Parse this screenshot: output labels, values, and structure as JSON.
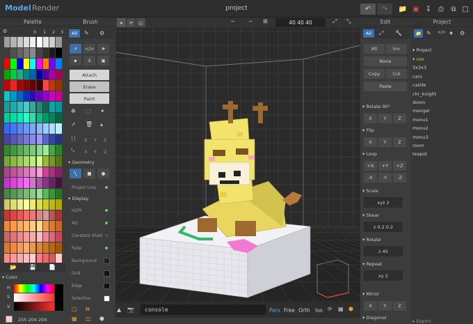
{
  "topbar": {
    "mode_model": "Model",
    "mode_render": "Render",
    "title": "project"
  },
  "palette": {
    "title": "Palette",
    "page_buttons": [
      "0",
      "1",
      "2",
      "3"
    ],
    "color_label": "Color",
    "hsv_labels": [
      "H",
      "S",
      "V"
    ],
    "rgb_value": "255 204 204",
    "swatches": [
      [
        "#a0a0a0",
        "#b4b4b4",
        "#c8c8c8",
        "#dcdcdc",
        "#f0f0f0",
        "#ffffff",
        "#e6e6e6",
        "#cfcfcf",
        "#9a9a9a"
      ],
      [
        "#3c3c3c",
        "#505050",
        "#646464",
        "#787878",
        "#8c8c8c",
        "#444444",
        "#303030",
        "#1c1c1c",
        "#000000"
      ],
      [
        "#ff0000",
        "#00ff00",
        "#0000ff",
        "#ffff00",
        "#00ffff",
        "#ff00ff",
        "#ff8000",
        "#8000ff",
        "#0080ff"
      ],
      [
        "#00aa00",
        "#00cc44",
        "#22aa88",
        "#008888",
        "#0066aa",
        "#0000aa",
        "#5500aa",
        "#aa00aa",
        "#aa0055"
      ],
      [
        "#cc0000",
        "#ee2222",
        "#aa0000",
        "#880000",
        "#660000",
        "#440000",
        "#ff4444",
        "#cc3300",
        "#993300"
      ],
      [
        "#00cccc",
        "#0099cc",
        "#0066cc",
        "#0033cc",
        "#3300cc",
        "#6600cc",
        "#9900cc",
        "#cc00cc",
        "#cc0099"
      ],
      [
        "#229999",
        "#22aaaa",
        "#33bbbb",
        "#44cccc",
        "#33aa99",
        "#228877",
        "#116655",
        "#00aaaa",
        "#009999"
      ],
      [
        "#00cc99",
        "#00ddaa",
        "#00eebb",
        "#22ffcc",
        "#33ddaa",
        "#11bb88",
        "#009966",
        "#008855",
        "#006644"
      ],
      [
        "#3366ff",
        "#4477ff",
        "#5588ff",
        "#6699ff",
        "#77aaff",
        "#88bbff",
        "#99ccff",
        "#aaddff",
        "#bbeeff"
      ],
      [
        "#4444aa",
        "#5555bb",
        "#6666cc",
        "#7777dd",
        "#8888ee",
        "#9999ff",
        "#5566cc",
        "#3344aa",
        "#223388"
      ],
      [
        "#338833",
        "#449944",
        "#55aa55",
        "#66bb66",
        "#77cc77",
        "#88dd88",
        "#99ee99",
        "#44aa44",
        "#228822"
      ],
      [
        "#77aa33",
        "#88bb44",
        "#99cc55",
        "#aadd66",
        "#bbee77",
        "#ccff88",
        "#99bb33",
        "#779922",
        "#557711"
      ],
      [
        "#aa4488",
        "#bb5599",
        "#cc66aa",
        "#dd77bb",
        "#ee88cc",
        "#ff99dd",
        "#cc4499",
        "#aa3377",
        "#882266"
      ],
      [
        "#cc33cc",
        "#dd44dd",
        "#ee55ee",
        "#ff66ff",
        "#cc77cc",
        "#aa55aa",
        "#883388",
        "#662266",
        "#441144"
      ],
      [
        "#448844",
        "#559955",
        "#66aa66",
        "#77bb77",
        "#88cc88",
        "#99dd99",
        "#55bb55",
        "#339933",
        "#227722"
      ],
      [
        "#cccc66",
        "#dddd77",
        "#eeee88",
        "#ffff99",
        "#eeee66",
        "#dddd44",
        "#cccc22",
        "#bbbb00",
        "#aaaa00"
      ],
      [
        "#cc3333",
        "#dd4444",
        "#ee5555",
        "#ff6666",
        "#ee7777",
        "#dd8888",
        "#cc9999",
        "#bb5555",
        "#aa3333"
      ],
      [
        "#ee8833",
        "#ff9944",
        "#ffaa55",
        "#ffbb66",
        "#ffcc77",
        "#ffdd88",
        "#ee9955",
        "#dd7733",
        "#cc6622"
      ],
      [
        "#cc6666",
        "#dd7777",
        "#ee8888",
        "#ff9999",
        "#ffaaaa",
        "#ffbbbb",
        "#ee8899",
        "#dd6677",
        "#cc4455"
      ],
      [
        "#dd7733",
        "#ee8844",
        "#ff9955",
        "#ffaa66",
        "#ee9944",
        "#dd8833",
        "#cc7722",
        "#bb6611",
        "#aa5500"
      ],
      [
        "#ff8888",
        "#ff9999",
        "#ffaaaa",
        "#ffbbbb",
        "#ffcccc",
        "#ff7777",
        "#ee6666",
        "#dd5555",
        "#ffcccc"
      ]
    ]
  },
  "brush": {
    "title": "Brush",
    "all_tab": "All",
    "attach": "Attach",
    "erase": "Erase",
    "paint": "Paint",
    "mirror_xyz": [
      "X",
      "Y",
      "Z"
    ],
    "geometry_label": "Geometry",
    "project_line": "Project Line",
    "display_label": "Display",
    "display_items": [
      "HDPI",
      "AO",
      "Constant Shad",
      "Fade",
      "Background",
      "Grid",
      "Edge",
      "Selection"
    ]
  },
  "viewport": {
    "dimensions": "40 40 40",
    "console_placeholder": "console",
    "view_modes": [
      "Pers",
      "Free",
      "Orth",
      "Iso"
    ],
    "active_view": "Pers"
  },
  "edit": {
    "title": "Edit",
    "all_tab": "All",
    "select_all": "All",
    "select_inv": "Inv",
    "select_none": "None",
    "copy": "Copy",
    "cut": "Cut",
    "paste": "Paste",
    "rotate90_label": "Rotate 90°",
    "flip_label": "Flip",
    "loop_label": "Loop",
    "axes": [
      "X",
      "Y",
      "Z"
    ],
    "loop_plus": [
      "+X",
      "+Y",
      "+Z"
    ],
    "loop_minus": [
      "-X",
      "-Y",
      "-Z"
    ],
    "scale_label": "Scale",
    "scale_value": "xyz 2",
    "shear_label": "Shear",
    "shear_value": "z 0.2 0.2",
    "rotate_label": "Rotate",
    "rotate_value": "z 45",
    "repeat_label": "Repeat",
    "repeat_value": "xy 2",
    "mirror_label": "Mirror",
    "diagonal_label": "Diagonal"
  },
  "project": {
    "title": "Project",
    "root": "Project",
    "files": [
      "vox",
      "3x3x3",
      "cars",
      "castle",
      "chr_knight",
      "doom",
      "menger",
      "monu1",
      "monu2",
      "monu3",
      "room",
      "teapot"
    ],
    "active_file": "vox",
    "export_label": "Export"
  },
  "colors": {
    "accent": "#5aa8e8",
    "active_file": "#f0c040",
    "voxel_yellow": "#f2e36a",
    "voxel_white": "#f4f4f8"
  }
}
